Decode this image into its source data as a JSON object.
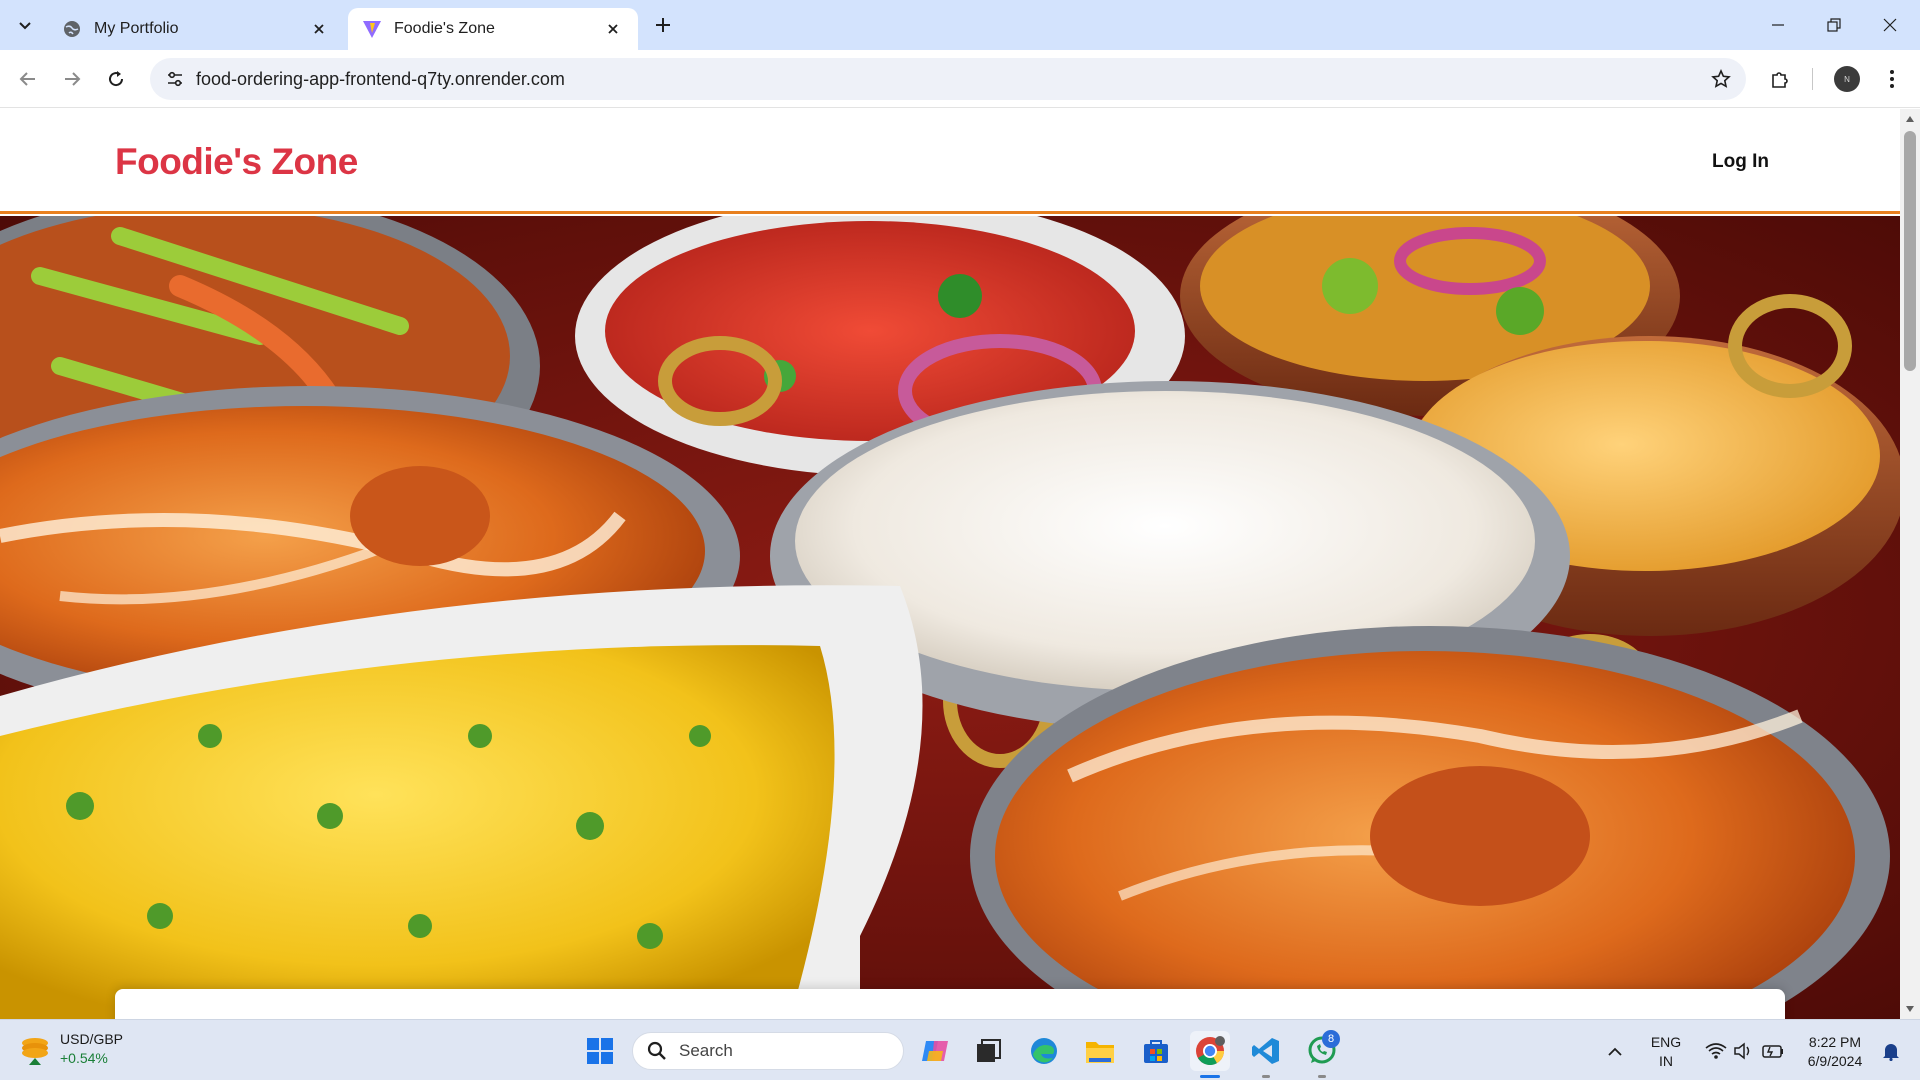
{
  "browser": {
    "tabs": [
      {
        "title": "My Portfolio",
        "active": false,
        "icon": "globe-icon"
      },
      {
        "title": "Foodie's Zone",
        "active": true,
        "icon": "vite-logo-icon"
      }
    ],
    "url": "food-ordering-app-frontend-q7ty.onrender.com",
    "profile_initials": "N"
  },
  "page": {
    "logo": "Foodie's Zone",
    "login_label": "Log In",
    "hero_image": "indian-food-spread-hero-image",
    "colors": {
      "brand": "#dc3545",
      "header_border": "#e8801f"
    }
  },
  "taskbar": {
    "widget": {
      "pair": "USD/GBP",
      "change": "+0.54%"
    },
    "search_placeholder": "Search",
    "language": {
      "line1": "ENG",
      "line2": "IN"
    },
    "time": "8:22 PM",
    "date": "6/9/2024",
    "whatsapp_badge": "8",
    "pinned": [
      "copilot-icon",
      "task-view-icon",
      "edge-icon",
      "file-explorer-icon",
      "store-icon",
      "chrome-icon",
      "vscode-icon",
      "whatsapp-icon"
    ]
  }
}
